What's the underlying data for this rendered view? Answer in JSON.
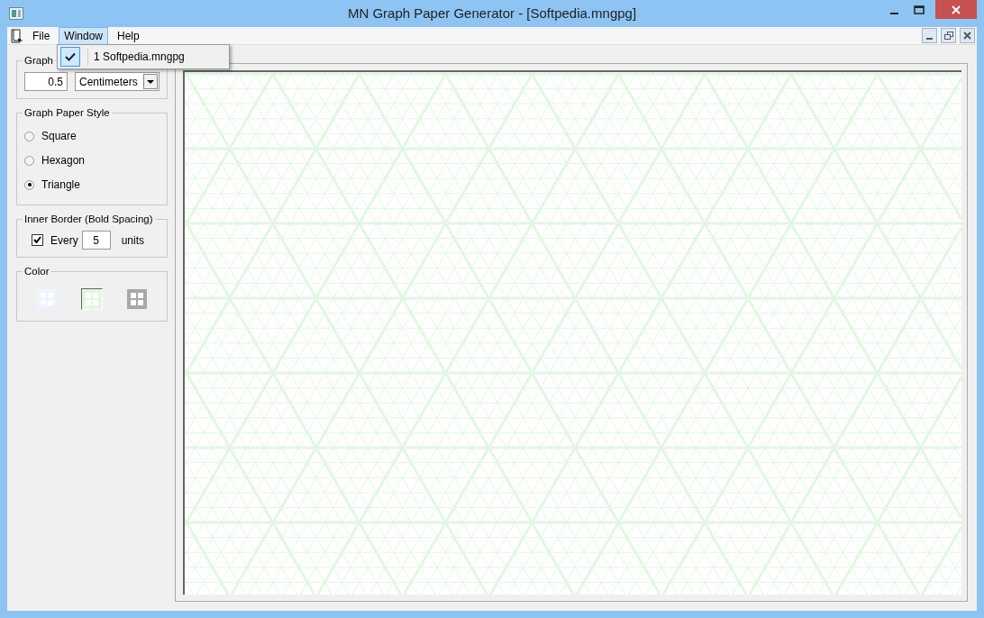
{
  "window": {
    "title": "MN Graph Paper Generator - [Softpedia.mngpg]"
  },
  "menu": [
    {
      "label": "File",
      "selected": false
    },
    {
      "label": "Window",
      "selected": true
    },
    {
      "label": "Help",
      "selected": false
    }
  ],
  "window_menu": [
    {
      "label": "1 Softpedia.mngpg",
      "checked": true
    }
  ],
  "graph_size": {
    "title": "Graph",
    "value": "0.5",
    "unit": "Centimeters"
  },
  "style_group": {
    "title": "Graph Paper Style",
    "options": [
      {
        "label": "Square",
        "selected": false
      },
      {
        "label": "Hexagon",
        "selected": false
      },
      {
        "label": "Triangle",
        "selected": true
      }
    ]
  },
  "inner_border": {
    "title": "Inner Border (Bold Spacing)",
    "checked": true,
    "label": "Every",
    "value": "5",
    "suffix": "units"
  },
  "color_group": {
    "title": "Color",
    "swatches": [
      {
        "color": "#eef3ff",
        "selected": false
      },
      {
        "color": "#e2f7e2",
        "selected": true
      },
      {
        "color": "#a8a8a8",
        "selected": false
      }
    ]
  }
}
